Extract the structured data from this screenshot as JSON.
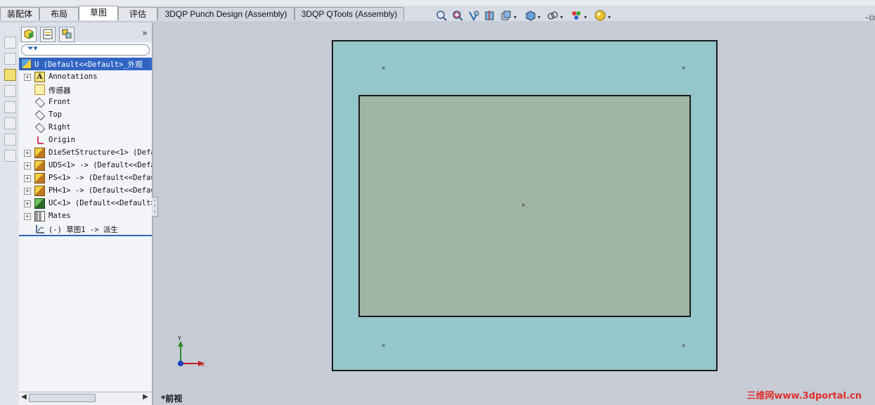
{
  "tabs": [
    {
      "label": "装配体",
      "active": false
    },
    {
      "label": "布局",
      "active": false
    },
    {
      "label": "草图",
      "active": true
    },
    {
      "label": "评估",
      "active": false
    },
    {
      "label": "3DQP Punch Design (Assembly)",
      "active": false
    },
    {
      "label": "3DQP QTools (Assembly)",
      "active": false
    }
  ],
  "view_toolbar": {
    "icons": [
      "zoom-to-fit-icon",
      "zoom-to-area-icon",
      "previous-view-icon",
      "section-view-icon",
      "view-orientation-icon",
      "display-style-icon",
      "hide-show-items-icon",
      "edit-appearance-icon",
      "apply-scene-icon"
    ]
  },
  "panel": {
    "tabs": [
      "featuremanager-tab-icon",
      "propertymanager-tab-icon",
      "configurationmanager-tab-icon"
    ],
    "more": "»",
    "filter_icon": "filter-icon"
  },
  "tree": {
    "root": "U  (Default<<Default>_外观",
    "items": [
      {
        "label": "Annotations",
        "icon": "annotations-icon",
        "expandable": true
      },
      {
        "label": "传感器",
        "icon": "sensor-icon",
        "expandable": false
      },
      {
        "label": "Front",
        "icon": "plane-icon",
        "expandable": false
      },
      {
        "label": "Top",
        "icon": "plane-icon",
        "expandable": false
      },
      {
        "label": "Right",
        "icon": "plane-icon",
        "expandable": false
      },
      {
        "label": "Origin",
        "icon": "origin-icon",
        "expandable": false
      },
      {
        "label": "DieSetStructure<1> (Defa",
        "icon": "subassembly-icon",
        "expandable": true
      },
      {
        "label": "UDS<1> -> (Default<<Defa",
        "icon": "subassembly-icon",
        "expandable": true
      },
      {
        "label": "PS<1> -> (Default<<Defau",
        "icon": "subassembly-icon",
        "expandable": true
      },
      {
        "label": "PH<1> -> (Default<<Defau",
        "icon": "subassembly-icon",
        "expandable": true
      },
      {
        "label": "UC<1> (Default<<Default>",
        "icon": "subassembly-green-icon",
        "expandable": true
      },
      {
        "label": "Mates",
        "icon": "mates-icon",
        "expandable": true
      },
      {
        "label": "(-) 草图1 -> 派生",
        "icon": "sketch-icon",
        "expandable": false
      }
    ]
  },
  "graphics": {
    "outer_color": "#95c6cb",
    "inner_color": "#9fb5a6",
    "point_marker": "*"
  },
  "triad": {
    "y_label": "Y",
    "x_label": "X"
  },
  "view_name": "*前视",
  "watermark": "三维网www.3dportal.cn",
  "window_buttons": "–⧉"
}
